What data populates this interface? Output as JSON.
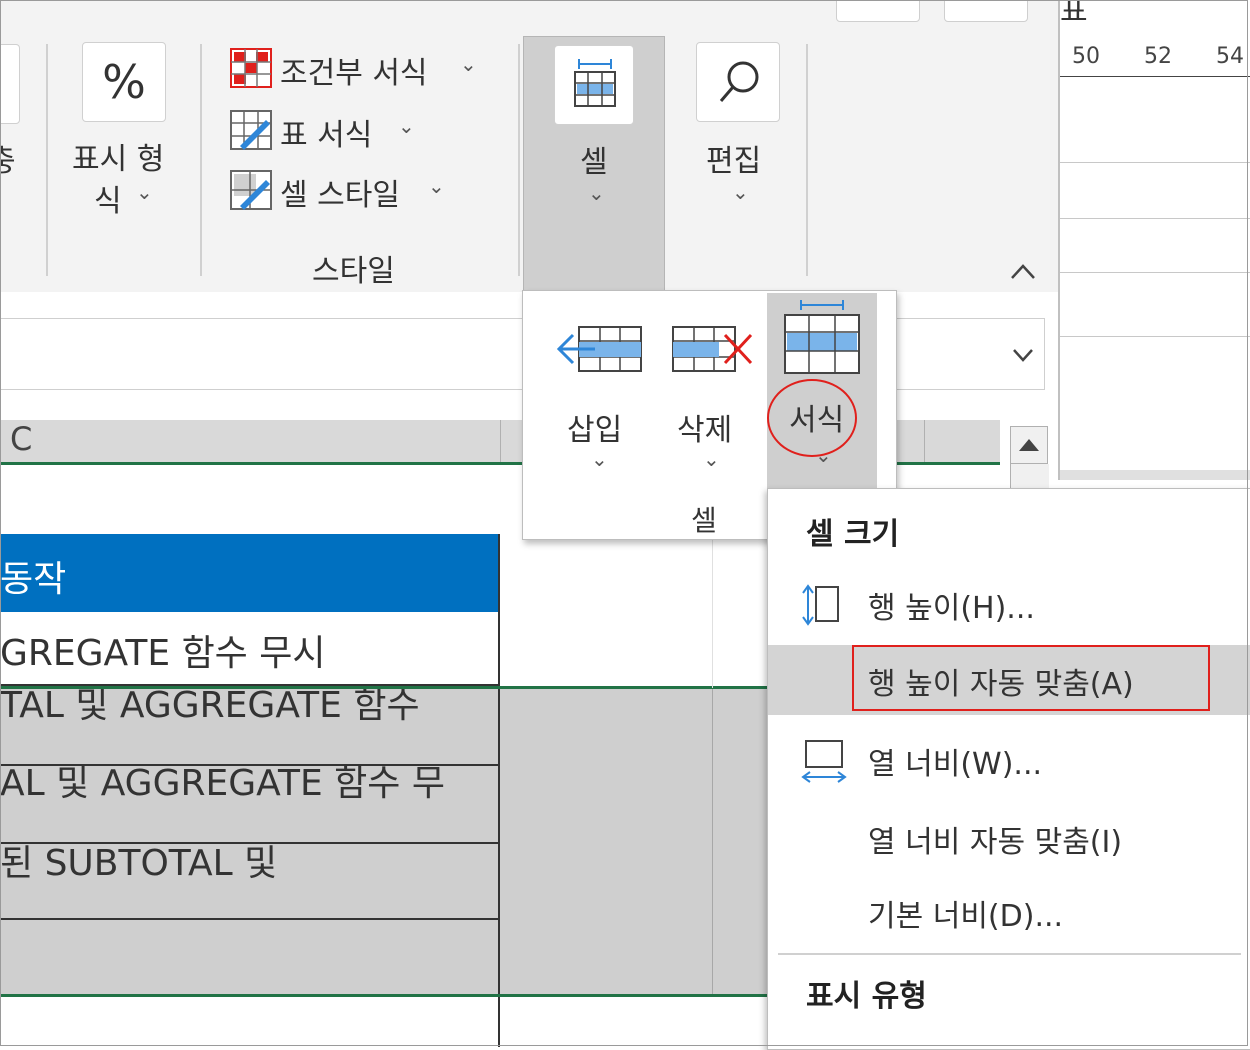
{
  "ribbon": {
    "partial_left_label": "충",
    "number_format": {
      "icon_glyph": "%",
      "label_line1": "표시 형",
      "label_line2": "식"
    },
    "styles_group": {
      "conditional_formatting": "조건부 서식",
      "format_as_table": "표 서식",
      "cell_styles": "셀 스타일",
      "group_label": "스타일"
    },
    "cells_button": {
      "label": "셀"
    },
    "editing_button": {
      "label": "편집"
    },
    "chevron_down": "⌄",
    "collapse_glyph": "^"
  },
  "right_sheet": {
    "header_partial": "표",
    "ruler": [
      "50",
      "52",
      "54"
    ]
  },
  "formula_bar": {
    "expand_glyph": "⌄"
  },
  "grid": {
    "column_header": "C",
    "rows": [
      "",
      "동작",
      "GREGATE 함수 무시",
      "TAL 및 AGGREGATE 함수",
      "AL 및 AGGREGATE 함수 무",
      "된 SUBTOTAL 및",
      ""
    ]
  },
  "cells_panel": {
    "insert": "삽입",
    "delete": "삭제",
    "format": "서식",
    "group_label": "셀"
  },
  "format_menu": {
    "section_cell_size": "셀 크기",
    "row_height": "행 높이(H)...",
    "autofit_row_height": "행 높이 자동 맞춤(A)",
    "column_width": "열 너비(W)...",
    "autofit_column_width": "열 너비 자동 맞춤(I)",
    "default_width": "기본 너비(D)...",
    "section_visibility": "표시 유형"
  },
  "colors": {
    "selected_cell": "#0070c0",
    "excel_green": "#217346",
    "highlight_red": "#e0201c",
    "menu_hover": "#d4d4d4",
    "icon_blue": "#2e86d8"
  }
}
